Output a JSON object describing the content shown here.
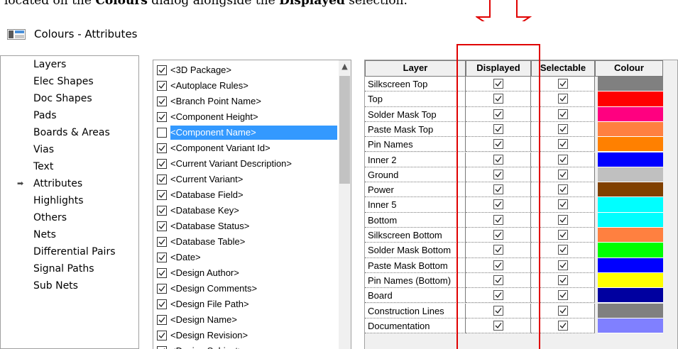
{
  "caption": {
    "part1": "located on the ",
    "bold1": "Colours",
    "part2": " dialog alongside the ",
    "bold2": "Displayed",
    "part3": " selection."
  },
  "window": {
    "title": "Colours - Attributes"
  },
  "nav": {
    "selected_index": 7,
    "items": [
      "Layers",
      "Elec Shapes",
      "Doc Shapes",
      "Pads",
      "Boards & Areas",
      "Vias",
      "Text",
      "Attributes",
      "Highlights",
      "Others",
      "Nets",
      "Differential Pairs",
      "Signal Paths",
      "Sub Nets"
    ]
  },
  "attributes": [
    {
      "label": "<3D Package>",
      "checked": true,
      "selected": false
    },
    {
      "label": "<Autoplace Rules>",
      "checked": true,
      "selected": false
    },
    {
      "label": "<Branch Point Name>",
      "checked": true,
      "selected": false
    },
    {
      "label": "<Component Height>",
      "checked": true,
      "selected": false
    },
    {
      "label": "<Component Name>",
      "checked": false,
      "selected": true
    },
    {
      "label": "<Component Variant Id>",
      "checked": true,
      "selected": false
    },
    {
      "label": "<Current Variant Description>",
      "checked": true,
      "selected": false
    },
    {
      "label": "<Current Variant>",
      "checked": true,
      "selected": false
    },
    {
      "label": "<Database Field>",
      "checked": true,
      "selected": false
    },
    {
      "label": "<Database Key>",
      "checked": true,
      "selected": false
    },
    {
      "label": "<Database Status>",
      "checked": true,
      "selected": false
    },
    {
      "label": "<Database Table>",
      "checked": true,
      "selected": false
    },
    {
      "label": "<Date>",
      "checked": true,
      "selected": false
    },
    {
      "label": "<Design Author>",
      "checked": true,
      "selected": false
    },
    {
      "label": "<Design Comments>",
      "checked": true,
      "selected": false
    },
    {
      "label": "<Design File Path>",
      "checked": true,
      "selected": false
    },
    {
      "label": "<Design Name>",
      "checked": true,
      "selected": false
    },
    {
      "label": "<Design Revision>",
      "checked": true,
      "selected": false
    },
    {
      "label": "<Design Subject>",
      "checked": true,
      "selected": false
    }
  ],
  "grid": {
    "headers": {
      "layer": "Layer",
      "displayed": "Displayed",
      "selectable": "Selectable",
      "colour": "Colour"
    },
    "rows": [
      {
        "layer": "Silkscreen Top",
        "displayed": true,
        "selectable": true,
        "colour": "#808080"
      },
      {
        "layer": "Top",
        "displayed": true,
        "selectable": true,
        "colour": "#ff0000"
      },
      {
        "layer": "Solder Mask Top",
        "displayed": true,
        "selectable": true,
        "colour": "#ff0080"
      },
      {
        "layer": "Paste Mask Top",
        "displayed": true,
        "selectable": true,
        "colour": "#ff8040"
      },
      {
        "layer": "Pin Names",
        "displayed": true,
        "selectable": true,
        "colour": "#ff8000"
      },
      {
        "layer": "Inner 2",
        "displayed": true,
        "selectable": true,
        "colour": "#0000ff"
      },
      {
        "layer": "Ground",
        "displayed": true,
        "selectable": true,
        "colour": "#c0c0c0"
      },
      {
        "layer": "Power",
        "displayed": true,
        "selectable": true,
        "colour": "#804000"
      },
      {
        "layer": "Inner 5",
        "displayed": true,
        "selectable": true,
        "colour": "#00ffff"
      },
      {
        "layer": "Bottom",
        "displayed": true,
        "selectable": true,
        "colour": "#00ffff"
      },
      {
        "layer": "Silkscreen Bottom",
        "displayed": true,
        "selectable": true,
        "colour": "#ff8040"
      },
      {
        "layer": "Solder Mask Bottom",
        "displayed": true,
        "selectable": true,
        "colour": "#00ff00"
      },
      {
        "layer": "Paste Mask Bottom",
        "displayed": true,
        "selectable": true,
        "colour": "#0000ff"
      },
      {
        "layer": "Pin Names (Bottom)",
        "displayed": true,
        "selectable": true,
        "colour": "#ffff00"
      },
      {
        "layer": "Board",
        "displayed": true,
        "selectable": true,
        "colour": "#0000a0"
      },
      {
        "layer": "Construction Lines",
        "displayed": true,
        "selectable": true,
        "colour": "#808080"
      },
      {
        "layer": "Documentation",
        "displayed": true,
        "selectable": true,
        "colour": "#8080ff"
      }
    ]
  },
  "colors": {
    "annotation": "#e00000",
    "selection": "#3399ff"
  }
}
